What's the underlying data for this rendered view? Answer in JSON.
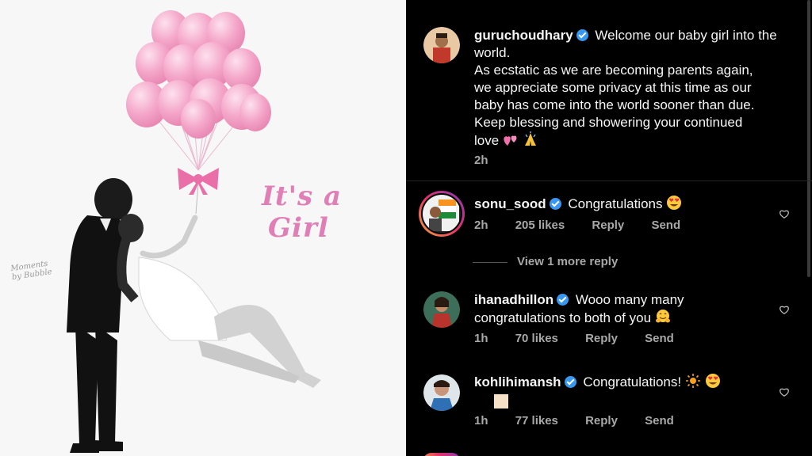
{
  "photo": {
    "caption_line1": "It's a",
    "caption_line2": "Girl",
    "watermark": "Moments by Bubble"
  },
  "post": {
    "username": "guruchoudhary",
    "caption": "Welcome our baby girl into the world.",
    "caption_line2": "As ecstatic as we are becoming parents again,",
    "caption_line3": "we appreciate some privacy at this time as our",
    "caption_line4": "baby has come into the world sooner than due.",
    "caption_line5": "Keep blessing and showering your continued",
    "caption_line6": "love",
    "time": "2h"
  },
  "comments": [
    {
      "username": "sonu_sood",
      "text": "Congratulations",
      "time": "2h",
      "likes": "205 likes",
      "reply": "Reply",
      "send": "Send"
    },
    {
      "username": "ihanadhillon",
      "text": "Wooo many many",
      "text_line2": "congratulations to both of you",
      "time": "1h",
      "likes": "70 likes",
      "reply": "Reply",
      "send": "Send"
    },
    {
      "username": "kohlihimansh",
      "text": "Congratulations!",
      "time": "1h",
      "likes": "77 likes",
      "reply": "Reply",
      "send": "Send"
    }
  ],
  "view_more_replies": "View 1 more reply",
  "colors": {
    "background": "#000000",
    "verified": "#3897f0",
    "meta_text": "#a8a8a8",
    "balloon": "#f4a6c9",
    "caption_pink": "#e07fb6"
  }
}
